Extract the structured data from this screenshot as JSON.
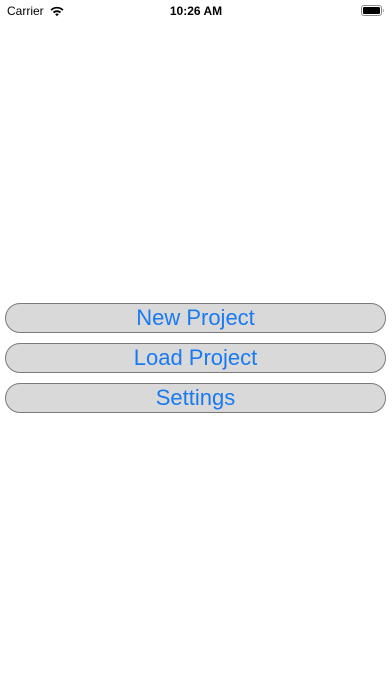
{
  "status_bar": {
    "carrier": "Carrier",
    "time": "10:26 AM",
    "icons": [
      "wifi-icon",
      "battery-icon"
    ]
  },
  "menu": {
    "new_project_label": "New Project",
    "load_project_label": "Load Project",
    "settings_label": "Settings"
  },
  "colors": {
    "button_text": "#1a7af0",
    "button_fill": "#d9d9d9",
    "button_border": "#7a7a7a",
    "background": "#ffffff"
  }
}
